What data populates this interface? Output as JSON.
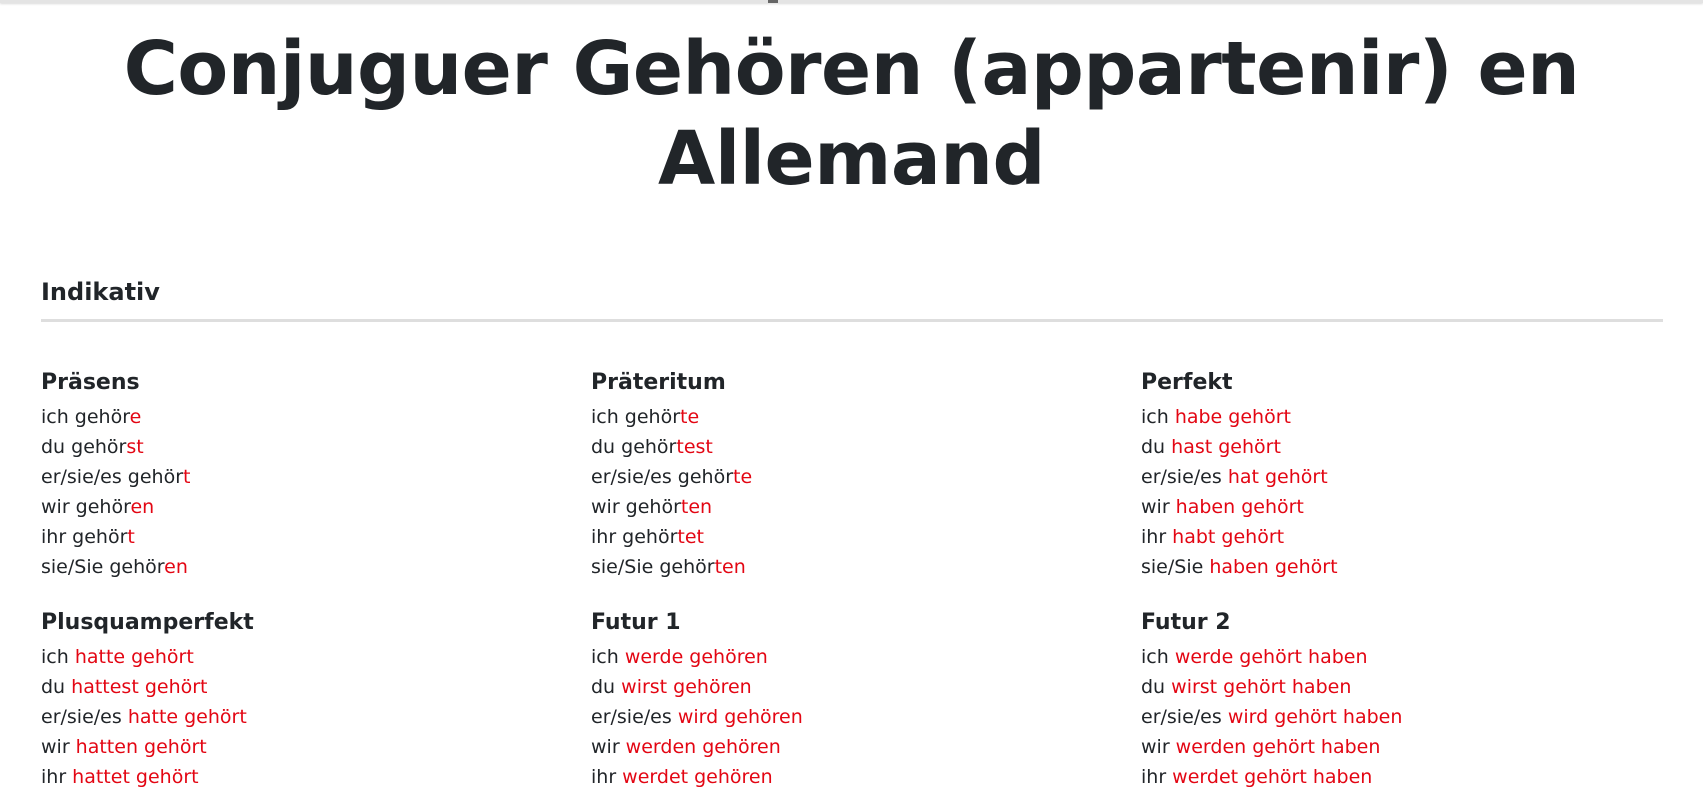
{
  "page": {
    "title": "Conjuguer Gehören (appartenir) en Allemand",
    "section_title": "Indikativ"
  },
  "colors": {
    "text": "#212529",
    "ending": "#e30613",
    "rule": "#dedede"
  },
  "tenses": [
    {
      "name": "Präsens",
      "rows": [
        {
          "pronoun": "ich gehör",
          "ending": "e"
        },
        {
          "pronoun": "du gehör",
          "ending": "st"
        },
        {
          "pronoun": "er/sie/es gehör",
          "ending": "t"
        },
        {
          "pronoun": "wir gehör",
          "ending": "en"
        },
        {
          "pronoun": "ihr gehör",
          "ending": "t"
        },
        {
          "pronoun": "sie/Sie gehör",
          "ending": "en"
        }
      ]
    },
    {
      "name": "Präteritum",
      "rows": [
        {
          "pronoun": "ich gehör",
          "ending": "te"
        },
        {
          "pronoun": "du gehör",
          "ending": "test"
        },
        {
          "pronoun": "er/sie/es gehör",
          "ending": "te"
        },
        {
          "pronoun": "wir gehör",
          "ending": "ten"
        },
        {
          "pronoun": "ihr gehör",
          "ending": "tet"
        },
        {
          "pronoun": "sie/Sie gehör",
          "ending": "ten"
        }
      ]
    },
    {
      "name": "Perfekt",
      "rows": [
        {
          "pronoun": "ich ",
          "ending": "habe gehört"
        },
        {
          "pronoun": "du ",
          "ending": "hast gehört"
        },
        {
          "pronoun": "er/sie/es ",
          "ending": "hat gehört"
        },
        {
          "pronoun": "wir ",
          "ending": "haben gehört"
        },
        {
          "pronoun": "ihr ",
          "ending": "habt gehört"
        },
        {
          "pronoun": "sie/Sie ",
          "ending": "haben gehört"
        }
      ]
    },
    {
      "name": "Plusquamperfekt",
      "rows": [
        {
          "pronoun": "ich ",
          "ending": "hatte gehört"
        },
        {
          "pronoun": "du ",
          "ending": "hattest gehört"
        },
        {
          "pronoun": "er/sie/es ",
          "ending": "hatte gehört"
        },
        {
          "pronoun": "wir ",
          "ending": "hatten gehört"
        },
        {
          "pronoun": "ihr ",
          "ending": "hattet gehört"
        }
      ]
    },
    {
      "name": "Futur 1",
      "rows": [
        {
          "pronoun": "ich ",
          "ending": "werde gehören"
        },
        {
          "pronoun": "du ",
          "ending": "wirst gehören"
        },
        {
          "pronoun": "er/sie/es ",
          "ending": "wird gehören"
        },
        {
          "pronoun": "wir ",
          "ending": "werden gehören"
        },
        {
          "pronoun": "ihr ",
          "ending": "werdet gehören"
        }
      ]
    },
    {
      "name": "Futur 2",
      "rows": [
        {
          "pronoun": "ich ",
          "ending": "werde gehört haben"
        },
        {
          "pronoun": "du ",
          "ending": "wirst gehört haben"
        },
        {
          "pronoun": "er/sie/es ",
          "ending": "wird gehört haben"
        },
        {
          "pronoun": "wir ",
          "ending": "werden gehört haben"
        },
        {
          "pronoun": "ihr ",
          "ending": "werdet gehört haben"
        }
      ]
    }
  ]
}
